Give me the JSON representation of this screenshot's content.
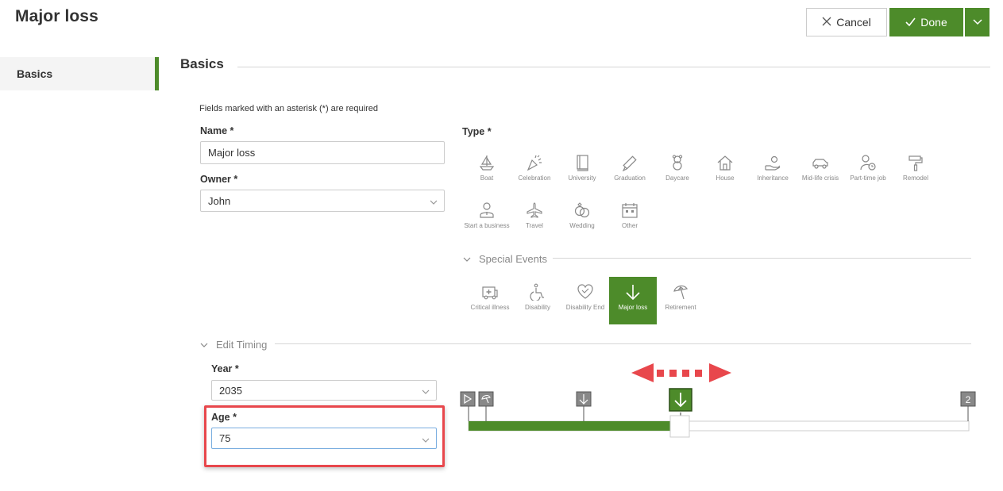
{
  "page": {
    "title": "Major loss"
  },
  "header": {
    "cancel_label": "Cancel",
    "done_label": "Done"
  },
  "sidebar": {
    "items": [
      {
        "label": "Basics",
        "active": true
      }
    ]
  },
  "section": {
    "title": "Basics",
    "required_note": "Fields marked with an asterisk (*) are required"
  },
  "form": {
    "name": {
      "label": "Name *",
      "value": "Major loss"
    },
    "owner": {
      "label": "Owner *",
      "value": "John"
    },
    "type": {
      "label": "Type *"
    }
  },
  "types": [
    {
      "label": "Boat",
      "icon": "boat-icon"
    },
    {
      "label": "Celebration",
      "icon": "celebration-icon"
    },
    {
      "label": "University",
      "icon": "book-icon"
    },
    {
      "label": "Graduation",
      "icon": "diploma-icon"
    },
    {
      "label": "Daycare",
      "icon": "teddy-bear-icon"
    },
    {
      "label": "House",
      "icon": "house-icon"
    },
    {
      "label": "Inheritance",
      "icon": "inheritance-icon"
    },
    {
      "label": "Mid-life crisis",
      "icon": "car-icon"
    },
    {
      "label": "Part-time job",
      "icon": "part-time-job-icon"
    },
    {
      "label": "Remodel",
      "icon": "paint-roller-icon"
    },
    {
      "label": "Start a business",
      "icon": "business-person-icon"
    },
    {
      "label": "Travel",
      "icon": "airplane-icon"
    },
    {
      "label": "Wedding",
      "icon": "rings-icon"
    },
    {
      "label": "Other",
      "icon": "calendar-icon"
    }
  ],
  "special_events": {
    "header": "Special Events",
    "items": [
      {
        "label": "Critical illness",
        "icon": "ambulance-icon",
        "selected": false
      },
      {
        "label": "Disability",
        "icon": "wheelchair-icon",
        "selected": false
      },
      {
        "label": "Disability End",
        "icon": "heart-icon",
        "selected": false
      },
      {
        "label": "Major loss",
        "icon": "arrow-down-icon",
        "selected": true
      },
      {
        "label": "Retirement",
        "icon": "beach-umbrella-icon",
        "selected": false
      }
    ]
  },
  "timing": {
    "header": "Edit Timing",
    "year": {
      "label": "Year *",
      "value": "2035"
    },
    "age": {
      "label": "Age *",
      "value": "75"
    }
  },
  "timeline": {
    "end_marker_label": "2",
    "progress": 0.42,
    "colors": {
      "accent": "#4d8b2a",
      "marker": "#888888",
      "annotation": "#e8474c"
    }
  }
}
